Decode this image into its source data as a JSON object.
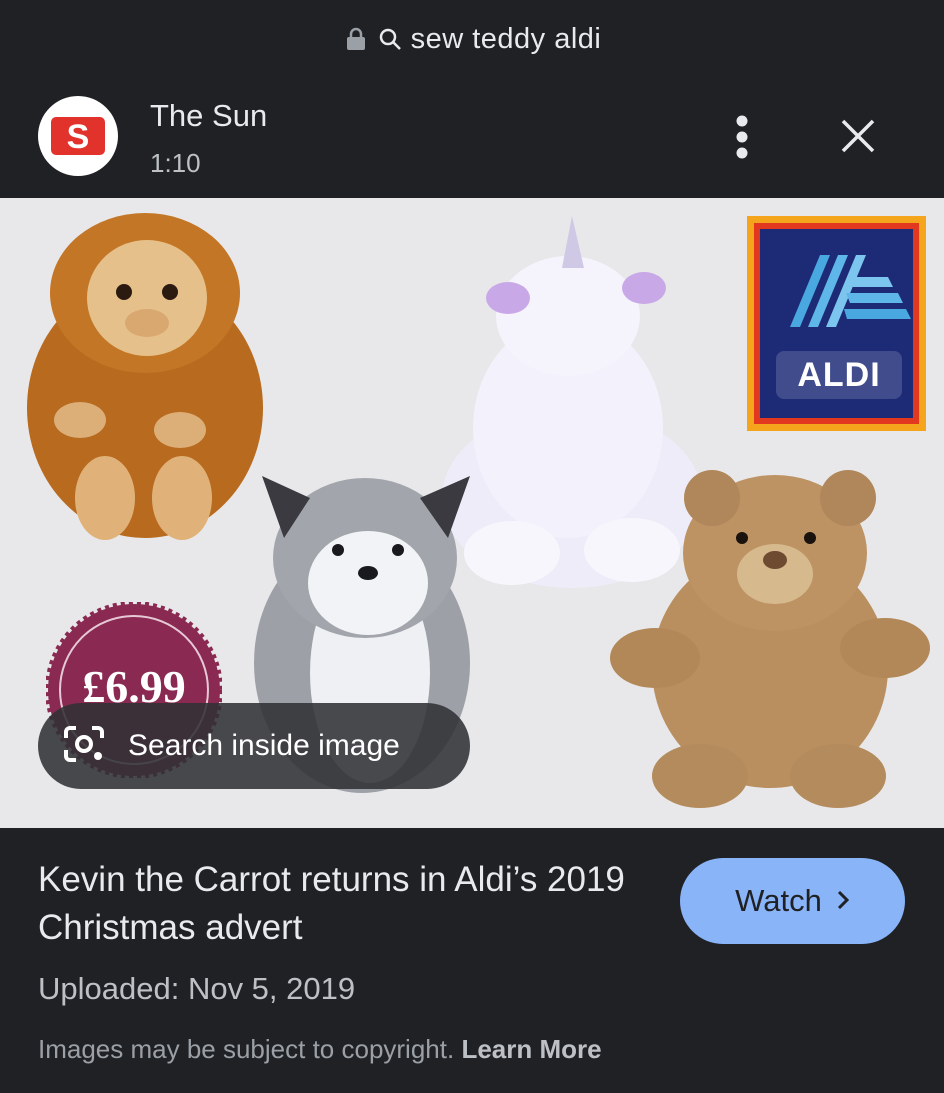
{
  "url_bar": {
    "query": "sew teddy aldi",
    "lock_icon": "lock-icon",
    "search_icon": "search-icon"
  },
  "source": {
    "name": "The Sun",
    "duration": "1:10",
    "logo_letter": "S"
  },
  "image": {
    "brand_logo_text": "ALDI",
    "price_badge": "£6.99",
    "search_inside_label": "Search inside image"
  },
  "result": {
    "title": "Kevin the Carrot returns in Aldi’s 2019 Christmas advert",
    "uploaded": "Uploaded: Nov 5, 2019",
    "watch_label": "Watch",
    "copyright_text": "Images may be subject to copyright.",
    "learn_more": "Learn More"
  },
  "colors": {
    "background": "#202124",
    "watch_button": "#8ab4f8",
    "sun_red": "#e2322c"
  }
}
